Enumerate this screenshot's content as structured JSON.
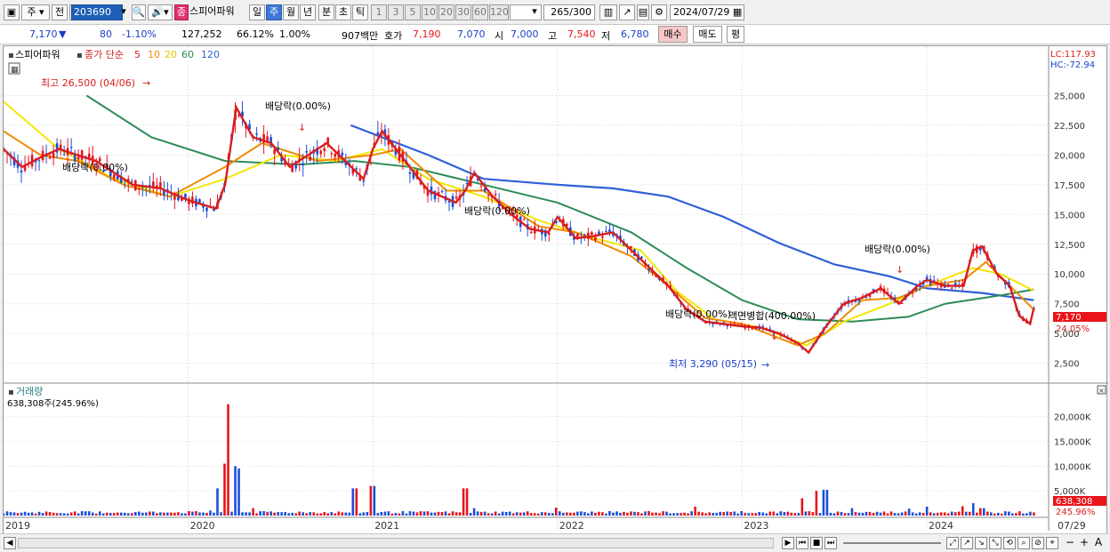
{
  "toolbar": {
    "period_select": "주",
    "before_label": "전",
    "stock_code": "203690",
    "stock_name": "스피어파워",
    "tabs": [
      "일",
      "주",
      "월",
      "년",
      "분",
      "초",
      "틱"
    ],
    "selected_tab": "주",
    "intervals": [
      "1",
      "3",
      "5",
      "10",
      "20",
      "30",
      "60",
      "120"
    ],
    "count": "265",
    "count_total": "/300",
    "date": "2024/07/29",
    "badge": "종"
  },
  "quote": {
    "price": "7,170",
    "change": "80",
    "change_pct": "-1.10%",
    "volume": "127,252",
    "vol_ratio": "66.12%",
    "turnover": "1.00%",
    "amount": "907백만",
    "ask_label": "호가",
    "ask1": "7,190",
    "ask2": "7,070",
    "open_label": "시",
    "open": "7,000",
    "high_label": "고",
    "high": "7,540",
    "low_label": "저",
    "low": "6,780",
    "buy_label": "매수",
    "sell_label": "매도",
    "eval_label": "평"
  },
  "chart_data": {
    "type": "candlestick",
    "stock_name": "스피어파워",
    "legend": {
      "series_label": "종가 단순",
      "periods": [
        "5",
        "10",
        "20",
        "60",
        "120"
      ],
      "colors": [
        "#d81e1e",
        "#f08c00",
        "#f2e600",
        "#2e8b57",
        "#2f5fd8"
      ]
    },
    "y_ticks": [
      25000,
      22500,
      20000,
      17500,
      15000,
      12500,
      10000,
      7500,
      5000,
      2500
    ],
    "y_tick_labels": [
      "25,000",
      "22,500",
      "20,000",
      "17,500",
      "15,000",
      "12,500",
      "10,000",
      "7,500",
      "5,000",
      "2,500"
    ],
    "y_range": [
      1500,
      27500
    ],
    "x_labels": [
      "2019",
      "2020",
      "2021",
      "2022",
      "2023",
      "2024",
      "07/29"
    ],
    "lc_label": "LC:117.93",
    "hc_label": "HC:-72.94",
    "last_price_tag": "7,170",
    "last_pct_tag": "24.05%",
    "annotations": [
      {
        "text": "최고 26,500 (04/06)"
      },
      {
        "text": "배당락(0.00%)"
      },
      {
        "text": "배당락(0.00%)"
      },
      {
        "text": "배당락(0.00%)"
      },
      {
        "text": "배당락(0.00%)"
      },
      {
        "text": "액면병합(400.00%)"
      },
      {
        "text": "최저 3,290 (05/15)"
      },
      {
        "text": "배당락(0.00%)"
      }
    ],
    "volume": {
      "title": "거래량",
      "value_label": "638,308주(245.96%)",
      "y_tick_labels": [
        "20,000K",
        "15,000K",
        "10,000K",
        "5,000K"
      ],
      "last_tag": "638,308",
      "last_pct": "245.96%"
    },
    "close_series": [
      [
        2019.0,
        20500
      ],
      [
        2019.1,
        19000
      ],
      [
        2019.2,
        19800
      ],
      [
        2019.3,
        20500
      ],
      [
        2019.5,
        19500
      ],
      [
        2019.7,
        17500
      ],
      [
        2019.85,
        17200
      ],
      [
        2020.0,
        16200
      ],
      [
        2020.15,
        15500
      ],
      [
        2020.2,
        17500
      ],
      [
        2020.26,
        24000
      ],
      [
        2020.35,
        21500
      ],
      [
        2020.45,
        21000
      ],
      [
        2020.55,
        19000
      ],
      [
        2020.65,
        20000
      ],
      [
        2020.75,
        21000
      ],
      [
        2020.85,
        19500
      ],
      [
        2020.95,
        18000
      ],
      [
        2021.0,
        20500
      ],
      [
        2021.05,
        22000
      ],
      [
        2021.1,
        21000
      ],
      [
        2021.2,
        19000
      ],
      [
        2021.3,
        17000
      ],
      [
        2021.45,
        16000
      ],
      [
        2021.5,
        17000
      ],
      [
        2021.55,
        18500
      ],
      [
        2021.65,
        16500
      ],
      [
        2021.75,
        15000
      ],
      [
        2021.85,
        13800
      ],
      [
        2021.95,
        13500
      ],
      [
        2022.0,
        14800
      ],
      [
        2022.1,
        13000
      ],
      [
        2022.2,
        13200
      ],
      [
        2022.3,
        13500
      ],
      [
        2022.4,
        12000
      ],
      [
        2022.5,
        10500
      ],
      [
        2022.6,
        9000
      ],
      [
        2022.7,
        7000
      ],
      [
        2022.8,
        6000
      ],
      [
        2022.9,
        5800
      ],
      [
        2023.0,
        5600
      ],
      [
        2023.1,
        5500
      ],
      [
        2023.2,
        5000
      ],
      [
        2023.3,
        4200
      ],
      [
        2023.36,
        3400
      ],
      [
        2023.45,
        5500
      ],
      [
        2023.55,
        7500
      ],
      [
        2023.65,
        8000
      ],
      [
        2023.75,
        8800
      ],
      [
        2023.85,
        7500
      ],
      [
        2023.95,
        9000
      ],
      [
        2024.0,
        9500
      ],
      [
        2024.1,
        9000
      ],
      [
        2024.2,
        9000
      ],
      [
        2024.25,
        12000
      ],
      [
        2024.3,
        12300
      ],
      [
        2024.38,
        10000
      ],
      [
        2024.45,
        9000
      ],
      [
        2024.5,
        6500
      ],
      [
        2024.56,
        5800
      ],
      [
        2024.58,
        7170
      ]
    ],
    "ma120_series": [
      [
        2020.88,
        22500
      ],
      [
        2021.3,
        20000
      ],
      [
        2021.6,
        18000
      ],
      [
        2022.0,
        17500
      ],
      [
        2022.3,
        17200
      ],
      [
        2022.6,
        16500
      ],
      [
        2022.9,
        14800
      ],
      [
        2023.2,
        12600
      ],
      [
        2023.5,
        10800
      ],
      [
        2023.8,
        9800
      ],
      [
        2024.0,
        8800
      ],
      [
        2024.3,
        8400
      ],
      [
        2024.58,
        7800
      ]
    ],
    "ma60_series": [
      [
        2019.45,
        25000
      ],
      [
        2019.8,
        21500
      ],
      [
        2020.2,
        19500
      ],
      [
        2020.6,
        19200
      ],
      [
        2020.9,
        19500
      ],
      [
        2021.2,
        19000
      ],
      [
        2021.6,
        17500
      ],
      [
        2022.0,
        16000
      ],
      [
        2022.4,
        13500
      ],
      [
        2022.7,
        10500
      ],
      [
        2023.0,
        7800
      ],
      [
        2023.3,
        6200
      ],
      [
        2023.6,
        6000
      ],
      [
        2023.9,
        6400
      ],
      [
        2024.1,
        7500
      ],
      [
        2024.4,
        8200
      ],
      [
        2024.58,
        8700
      ]
    ],
    "ma20_series": [
      [
        2019.0,
        24500
      ],
      [
        2019.3,
        20500
      ],
      [
        2019.6,
        18000
      ],
      [
        2019.9,
        16500
      ],
      [
        2020.2,
        18000
      ],
      [
        2020.5,
        20000
      ],
      [
        2020.8,
        19500
      ],
      [
        2021.05,
        20500
      ],
      [
        2021.3,
        18000
      ],
      [
        2021.6,
        16500
      ],
      [
        2021.9,
        14500
      ],
      [
        2022.2,
        13000
      ],
      [
        2022.45,
        12000
      ],
      [
        2022.65,
        8500
      ],
      [
        2022.85,
        6200
      ],
      [
        2023.1,
        5500
      ],
      [
        2023.35,
        4000
      ],
      [
        2023.55,
        6000
      ],
      [
        2023.8,
        7500
      ],
      [
        2024.0,
        9000
      ],
      [
        2024.25,
        10500
      ],
      [
        2024.4,
        10000
      ],
      [
        2024.58,
        8600
      ]
    ],
    "ma10_series": [
      [
        2019.0,
        22000
      ],
      [
        2019.2,
        20000
      ],
      [
        2019.4,
        19500
      ],
      [
        2019.65,
        17500
      ],
      [
        2019.9,
        16500
      ],
      [
        2020.2,
        19000
      ],
      [
        2020.4,
        21000
      ],
      [
        2020.7,
        19500
      ],
      [
        2021.0,
        20000
      ],
      [
        2021.15,
        20500
      ],
      [
        2021.4,
        17000
      ],
      [
        2021.6,
        17000
      ],
      [
        2021.9,
        14000
      ],
      [
        2022.1,
        13500
      ],
      [
        2022.4,
        11500
      ],
      [
        2022.6,
        9000
      ],
      [
        2022.8,
        6300
      ],
      [
        2023.0,
        5800
      ],
      [
        2023.3,
        4000
      ],
      [
        2023.45,
        5000
      ],
      [
        2023.65,
        7800
      ],
      [
        2023.85,
        8000
      ],
      [
        2024.0,
        9000
      ],
      [
        2024.2,
        9500
      ],
      [
        2024.32,
        11000
      ],
      [
        2024.45,
        9000
      ],
      [
        2024.58,
        7000
      ]
    ],
    "volume_series": [
      [
        2019.1,
        600
      ],
      [
        2019.3,
        500
      ],
      [
        2019.5,
        400
      ],
      [
        2019.7,
        500
      ],
      [
        2019.9,
        600
      ],
      [
        2020.0,
        900
      ],
      [
        2020.12,
        1000
      ],
      [
        2020.16,
        5500
      ],
      [
        2020.19,
        10500
      ],
      [
        2020.22,
        22500
      ],
      [
        2020.25,
        10000
      ],
      [
        2020.27,
        9500
      ],
      [
        2020.35,
        1500
      ],
      [
        2020.6,
        800
      ],
      [
        2020.9,
        5500
      ],
      [
        2021.0,
        6000
      ],
      [
        2021.5,
        5500
      ],
      [
        2021.55,
        1500
      ],
      [
        2021.8,
        600
      ],
      [
        2022.0,
        1600
      ],
      [
        2022.5,
        900
      ],
      [
        2022.75,
        1800
      ],
      [
        2023.0,
        900
      ],
      [
        2023.33,
        3500
      ],
      [
        2023.4,
        5000
      ],
      [
        2023.45,
        5200
      ],
      [
        2023.6,
        1500
      ],
      [
        2023.9,
        1400
      ],
      [
        2024.0,
        1800
      ],
      [
        2024.2,
        1900
      ],
      [
        2024.25,
        2500
      ],
      [
        2024.3,
        1500
      ],
      [
        2024.45,
        800
      ],
      [
        2024.58,
        638
      ]
    ]
  },
  "bottombar": {
    "zoom_out": "−",
    "zoom_in": "+",
    "font_btn": "A"
  }
}
